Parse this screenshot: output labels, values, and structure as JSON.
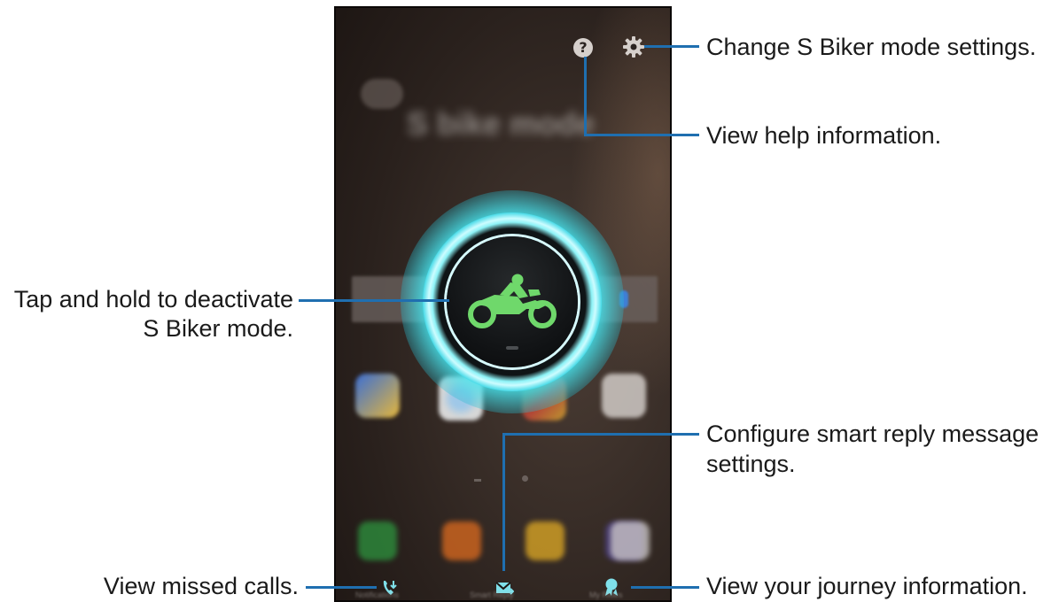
{
  "phone": {
    "background_app_title": "S bike mode",
    "help_icon": "?",
    "center_button_icon": "motorcycle-icon",
    "bottom_labels": [
      "Notifications",
      "Smart Reply",
      "My Rides"
    ]
  },
  "callouts": {
    "settings": "Change S Biker mode settings.",
    "help": "View help information.",
    "deactivate_line1": "Tap and hold to deactivate",
    "deactivate_line2": "S Biker mode.",
    "smart_reply_line1": "Configure smart reply message",
    "smart_reply_line2": "settings.",
    "missed_calls": "View missed calls.",
    "journey": "View your journey information."
  },
  "colors": {
    "callout_line": "#1f6fb0",
    "glow": "#46e6f0",
    "bike": "#6fd86b",
    "bottom_icons": "#7fe0ea"
  }
}
